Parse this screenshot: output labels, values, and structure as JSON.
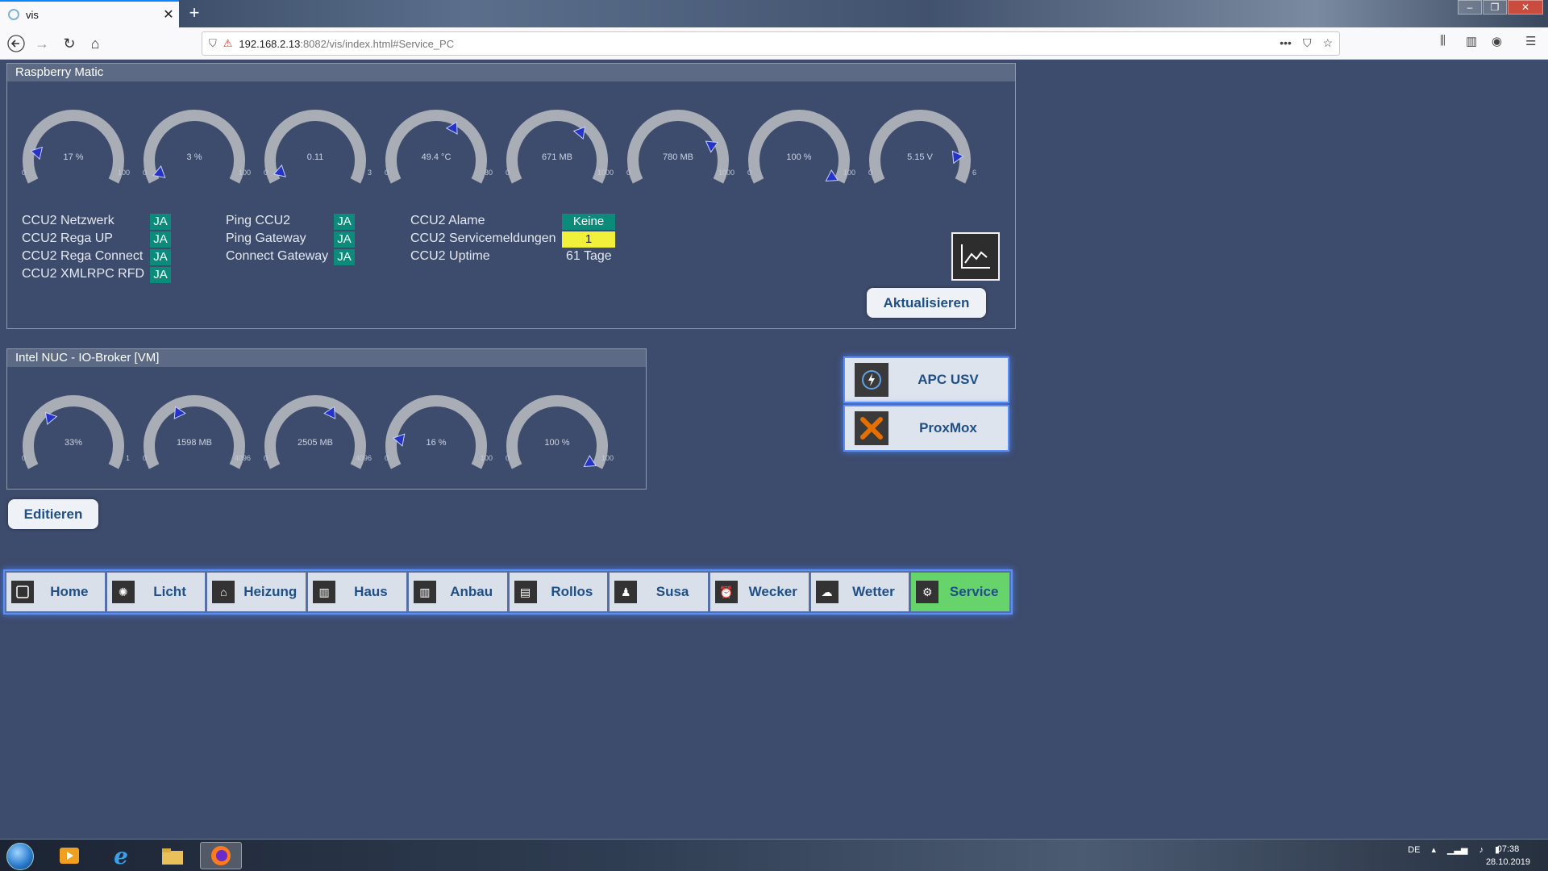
{
  "browser": {
    "tab_title": "vis",
    "url_host": "192.168.2.13",
    "url_path": ":8082/vis/index.html#Service_PC"
  },
  "raspberry": {
    "title": "Raspberry Matic",
    "gauges": [
      {
        "value_text": "17 %",
        "min": "0",
        "max": "100",
        "fraction": 0.17
      },
      {
        "value_text": "3 %",
        "min": "0",
        "max": "100",
        "fraction": 0.03
      },
      {
        "value_text": "0.11",
        "min": "0",
        "max": "3",
        "fraction": 0.037
      },
      {
        "value_text": "49.4 °C",
        "min": "0",
        "max": "80",
        "fraction": 0.62
      },
      {
        "value_text": "671 MB",
        "min": "0",
        "max": "1000",
        "fraction": 0.67
      },
      {
        "value_text": "780 MB",
        "min": "0",
        "max": "1000",
        "fraction": 0.78
      },
      {
        "value_text": "100 %",
        "min": "0",
        "max": "100",
        "fraction": 1.0
      },
      {
        "value_text": "5.15 V",
        "min": "0",
        "max": "6",
        "fraction": 0.86
      }
    ],
    "status_col1": [
      {
        "label": "CCU2 Netzwerk",
        "value": "JA"
      },
      {
        "label": "CCU2 Rega UP",
        "value": "JA"
      },
      {
        "label": "CCU2 Rega Connect",
        "value": "JA"
      },
      {
        "label": "CCU2 XMLRPC RFD",
        "value": "JA"
      }
    ],
    "status_col2": [
      {
        "label": "Ping CCU2",
        "value": "JA"
      },
      {
        "label": "Ping Gateway",
        "value": "JA"
      },
      {
        "label": "Connect Gateway",
        "value": "JA"
      }
    ],
    "status_col3": [
      {
        "label": "CCU2 Alame",
        "value": "Keine"
      },
      {
        "label": "CCU2 Servicemeldungen",
        "value": "1"
      },
      {
        "label": "CCU2 Uptime",
        "value": "61 Tage"
      }
    ],
    "refresh_label": "Aktualisieren"
  },
  "nuc": {
    "title": "Intel NUC - IO-Broker [VM]",
    "gauges": [
      {
        "value_text": "33%",
        "min": "0",
        "max": "1",
        "fraction": 0.33
      },
      {
        "value_text": "1598 MB",
        "min": "0",
        "max": "4096",
        "fraction": 0.39
      },
      {
        "value_text": "2505 MB",
        "min": "0",
        "max": "4096",
        "fraction": 0.61
      },
      {
        "value_text": "16 %",
        "min": "0",
        "max": "100",
        "fraction": 0.16
      },
      {
        "value_text": "100 %",
        "min": "0",
        "max": "100",
        "fraction": 1.0
      }
    ]
  },
  "edit_label": "Editieren",
  "services": [
    {
      "label": "APC USV",
      "icon": "power-cycle-icon"
    },
    {
      "label": "ProxMox",
      "icon": "proxmox-icon"
    }
  ],
  "menu": [
    {
      "label": "Home",
      "icon": "home-icon"
    },
    {
      "label": "Licht",
      "icon": "bulb-icon"
    },
    {
      "label": "Heizung",
      "icon": "house-heating-icon"
    },
    {
      "label": "Haus",
      "icon": "radiator-icon"
    },
    {
      "label": "Anbau",
      "icon": "radiator-icon"
    },
    {
      "label": "Rollos",
      "icon": "shutter-icon"
    },
    {
      "label": "Susa",
      "icon": "person-icon"
    },
    {
      "label": "Wecker",
      "icon": "alarm-clock-icon"
    },
    {
      "label": "Wetter",
      "icon": "weather-icon"
    },
    {
      "label": "Service",
      "icon": "gears-icon",
      "active": true
    }
  ],
  "taskbar": {
    "lang": "DE",
    "time": "07:38",
    "date": "28.10.2019"
  },
  "colors": {
    "page_bg": "#3d4b6c",
    "badge_ok": "#0c8a7a",
    "badge_warn": "#f1f03a",
    "menu_active": "#66d46a",
    "glow": "#5c8ff5"
  }
}
